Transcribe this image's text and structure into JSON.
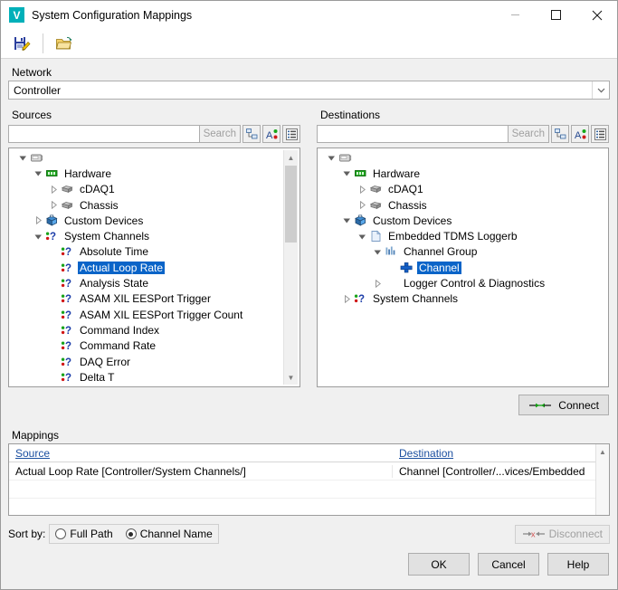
{
  "window": {
    "title": "System Configuration Mappings",
    "app_icon_letter": "V",
    "accent_color": "#00b0b9",
    "selection_color": "#0a64c8",
    "link_color": "#1b4fa0",
    "controls": {
      "minimize": "minimize-button",
      "maximize": "maximize-button",
      "close": "close-button"
    }
  },
  "toolbar": {
    "save_tooltip": "Save",
    "open_tooltip": "Open"
  },
  "network": {
    "label": "Network",
    "selected": "Controller",
    "options": [
      "Controller"
    ]
  },
  "sources": {
    "title": "Sources",
    "search": {
      "value": "",
      "placeholder": "",
      "button_label": "Search"
    },
    "view_buttons": [
      "tree-view-icon",
      "sort-alpha-icon",
      "list-view-icon"
    ],
    "tree": [
      {
        "label": "",
        "depth": 0,
        "icon": "controller-icon",
        "expander": "expanded",
        "selected": false
      },
      {
        "label": "Hardware",
        "depth": 1,
        "icon": "hardware-chip-icon",
        "expander": "expanded",
        "selected": false
      },
      {
        "label": "cDAQ1",
        "depth": 2,
        "icon": "device-box-icon",
        "expander": "collapsed",
        "selected": false
      },
      {
        "label": "Chassis",
        "depth": 2,
        "icon": "device-box-icon",
        "expander": "collapsed",
        "selected": false
      },
      {
        "label": "Custom Devices",
        "depth": 1,
        "icon": "custom-device-cube-icon",
        "expander": "collapsed",
        "selected": false
      },
      {
        "label": "System Channels",
        "depth": 1,
        "icon": "system-channel-icon",
        "expander": "expanded",
        "selected": false
      },
      {
        "label": "Absolute Time",
        "depth": 2,
        "icon": "system-channel-icon",
        "expander": "none",
        "selected": false
      },
      {
        "label": "Actual Loop Rate",
        "depth": 2,
        "icon": "system-channel-icon",
        "expander": "none",
        "selected": true
      },
      {
        "label": "Analysis State",
        "depth": 2,
        "icon": "system-channel-icon",
        "expander": "none",
        "selected": false
      },
      {
        "label": "ASAM XIL EESPort Trigger",
        "depth": 2,
        "icon": "system-channel-icon",
        "expander": "none",
        "selected": false
      },
      {
        "label": "ASAM XIL EESPort Trigger Count",
        "depth": 2,
        "icon": "system-channel-icon",
        "expander": "none",
        "selected": false
      },
      {
        "label": "Command Index",
        "depth": 2,
        "icon": "system-channel-icon",
        "expander": "none",
        "selected": false
      },
      {
        "label": "Command Rate",
        "depth": 2,
        "icon": "system-channel-icon",
        "expander": "none",
        "selected": false
      },
      {
        "label": "DAQ Error",
        "depth": 2,
        "icon": "system-channel-icon",
        "expander": "none",
        "selected": false
      },
      {
        "label": "Delta T",
        "depth": 2,
        "icon": "system-channel-icon",
        "expander": "none",
        "selected": false
      }
    ]
  },
  "destinations": {
    "title": "Destinations",
    "search": {
      "value": "",
      "placeholder": "",
      "button_label": "Search"
    },
    "view_buttons": [
      "tree-view-icon",
      "sort-alpha-icon",
      "list-view-icon"
    ],
    "tree": [
      {
        "label": "",
        "depth": 0,
        "icon": "controller-icon",
        "expander": "expanded",
        "selected": false
      },
      {
        "label": "Hardware",
        "depth": 1,
        "icon": "hardware-chip-icon",
        "expander": "expanded",
        "selected": false
      },
      {
        "label": "cDAQ1",
        "depth": 2,
        "icon": "device-box-icon",
        "expander": "collapsed",
        "selected": false
      },
      {
        "label": "Chassis",
        "depth": 2,
        "icon": "device-box-icon",
        "expander": "collapsed",
        "selected": false
      },
      {
        "label": "Custom Devices",
        "depth": 1,
        "icon": "custom-device-cube-icon",
        "expander": "expanded",
        "selected": false
      },
      {
        "label": "Embedded TDMS Loggerb",
        "depth": 2,
        "icon": "document-icon",
        "expander": "expanded",
        "selected": false
      },
      {
        "label": "Channel Group",
        "depth": 3,
        "icon": "channel-group-icon",
        "expander": "expanded",
        "selected": false
      },
      {
        "label": "Channel",
        "depth": 4,
        "icon": "channel-plus-icon",
        "expander": "none",
        "selected": true
      },
      {
        "label": "Logger Control & Diagnostics",
        "depth": 3,
        "icon": "none",
        "expander": "collapsed",
        "selected": false
      },
      {
        "label": "System Channels",
        "depth": 1,
        "icon": "system-channel-icon",
        "expander": "collapsed",
        "selected": false
      }
    ]
  },
  "connect_button": {
    "label": "Connect",
    "icon": "connect-arrows-icon",
    "enabled": true
  },
  "mappings": {
    "title": "Mappings",
    "columns": [
      "Source",
      "Destination"
    ],
    "rows": [
      {
        "source": "Actual Loop Rate [Controller/System Channels/]",
        "destination": "Channel  [Controller/...vices/Embedded"
      }
    ],
    "blank_rows": 2
  },
  "footer": {
    "sort_by_label": "Sort by:",
    "radios": [
      {
        "label": "Full Path",
        "checked": false
      },
      {
        "label": "Channel Name",
        "checked": true
      }
    ],
    "disconnect_button": {
      "label": "Disconnect",
      "icon": "disconnect-arrows-icon",
      "enabled": false
    },
    "buttons": [
      {
        "label": "OK",
        "name": "ok-button"
      },
      {
        "label": "Cancel",
        "name": "cancel-button"
      },
      {
        "label": "Help",
        "name": "help-button"
      }
    ]
  }
}
